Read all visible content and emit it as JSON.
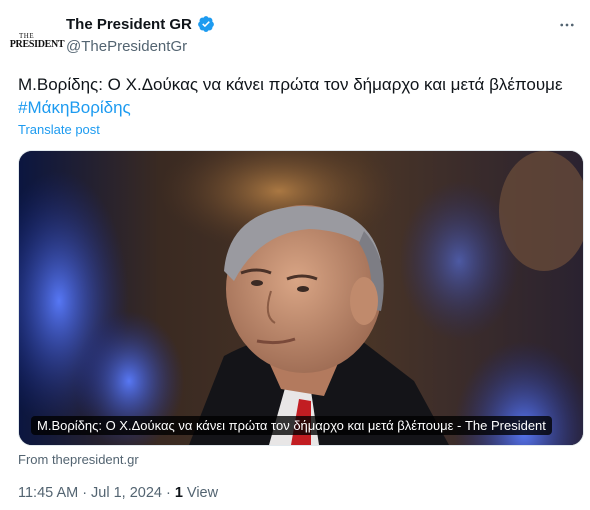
{
  "author": {
    "display_name": "The President GR",
    "handle": "@ThePresidentGr",
    "avatar_logo_line1": "THE",
    "avatar_logo_line2": "PRESIDENT",
    "verified_icon": "verified-badge-icon",
    "verified_color": "#1d9bf0"
  },
  "menu": {
    "icon": "more-horizontal-icon"
  },
  "tweet": {
    "text": "Μ.Βορίδης: Ο Χ.Δούκας να κάνει πρώτα τον δήμαρχο και μετά βλέπουμε",
    "hashtag": "#ΜάκηΒορίδης",
    "translate_label": "Translate post"
  },
  "media": {
    "caption": "Μ.Βορίδης: Ο Χ.Δούκας να κάνει πρώτα τον δήμαρχο και μετά βλέπουμε - The President"
  },
  "link_card": {
    "source_text": "From thepresident.gr"
  },
  "footer": {
    "time": "11:45 AM",
    "separator1": "·",
    "date": "Jul 1, 2024",
    "separator2": "·",
    "views_count": "1",
    "views_label": "View"
  },
  "colors": {
    "accent": "#1d9bf0",
    "text_primary": "#0f1419",
    "text_secondary": "#536471"
  }
}
